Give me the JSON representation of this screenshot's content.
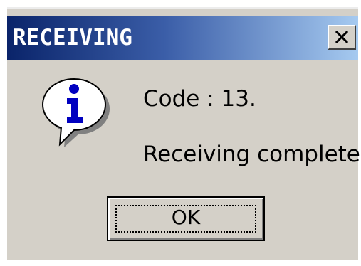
{
  "window": {
    "title": "RECEIVING",
    "close_icon": "close-icon"
  },
  "message": {
    "icon": "information-icon",
    "code_line": "Code : 13.",
    "status_line": "Receiving complete."
  },
  "buttons": {
    "ok_label": "OK"
  }
}
